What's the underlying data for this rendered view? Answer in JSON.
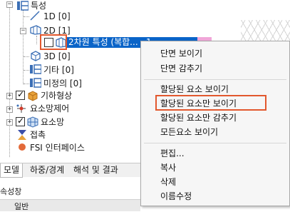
{
  "tree": {
    "root_label": "특성",
    "items": [
      {
        "label": "1D [0]"
      },
      {
        "label": "2D [1]"
      },
      {
        "label": "2차원 특성 (복합..."
      },
      {
        "label": "3D [0]"
      },
      {
        "label": "기타 [0]"
      },
      {
        "label": "미정의 [0]"
      },
      {
        "label": "기하형상"
      },
      {
        "label": "요소망제어"
      },
      {
        "label": "요소망"
      },
      {
        "label": "접촉"
      },
      {
        "label": "FSI 인터페이스"
      }
    ],
    "selected_suffix": "1"
  },
  "tabs": [
    {
      "label": "모델"
    },
    {
      "label": "하중/경계"
    },
    {
      "label": "해석 및 결과"
    }
  ],
  "panel": {
    "title": "속성창",
    "section": "일반"
  },
  "context_menu": {
    "group1": [
      "단면 보이기",
      "단면 감추기"
    ],
    "group2": [
      "할당된 요소 보이기",
      "할당된 요소만 보이기",
      "할당된 요소만 감추기",
      "모든요소 보이기"
    ],
    "group3": [
      "편집...",
      "복사",
      "삭제",
      "이름수정"
    ]
  },
  "colors": {
    "selection": "#0a64c8",
    "highlight": "#e2582e",
    "accent_pink": "#f0a6d8"
  }
}
